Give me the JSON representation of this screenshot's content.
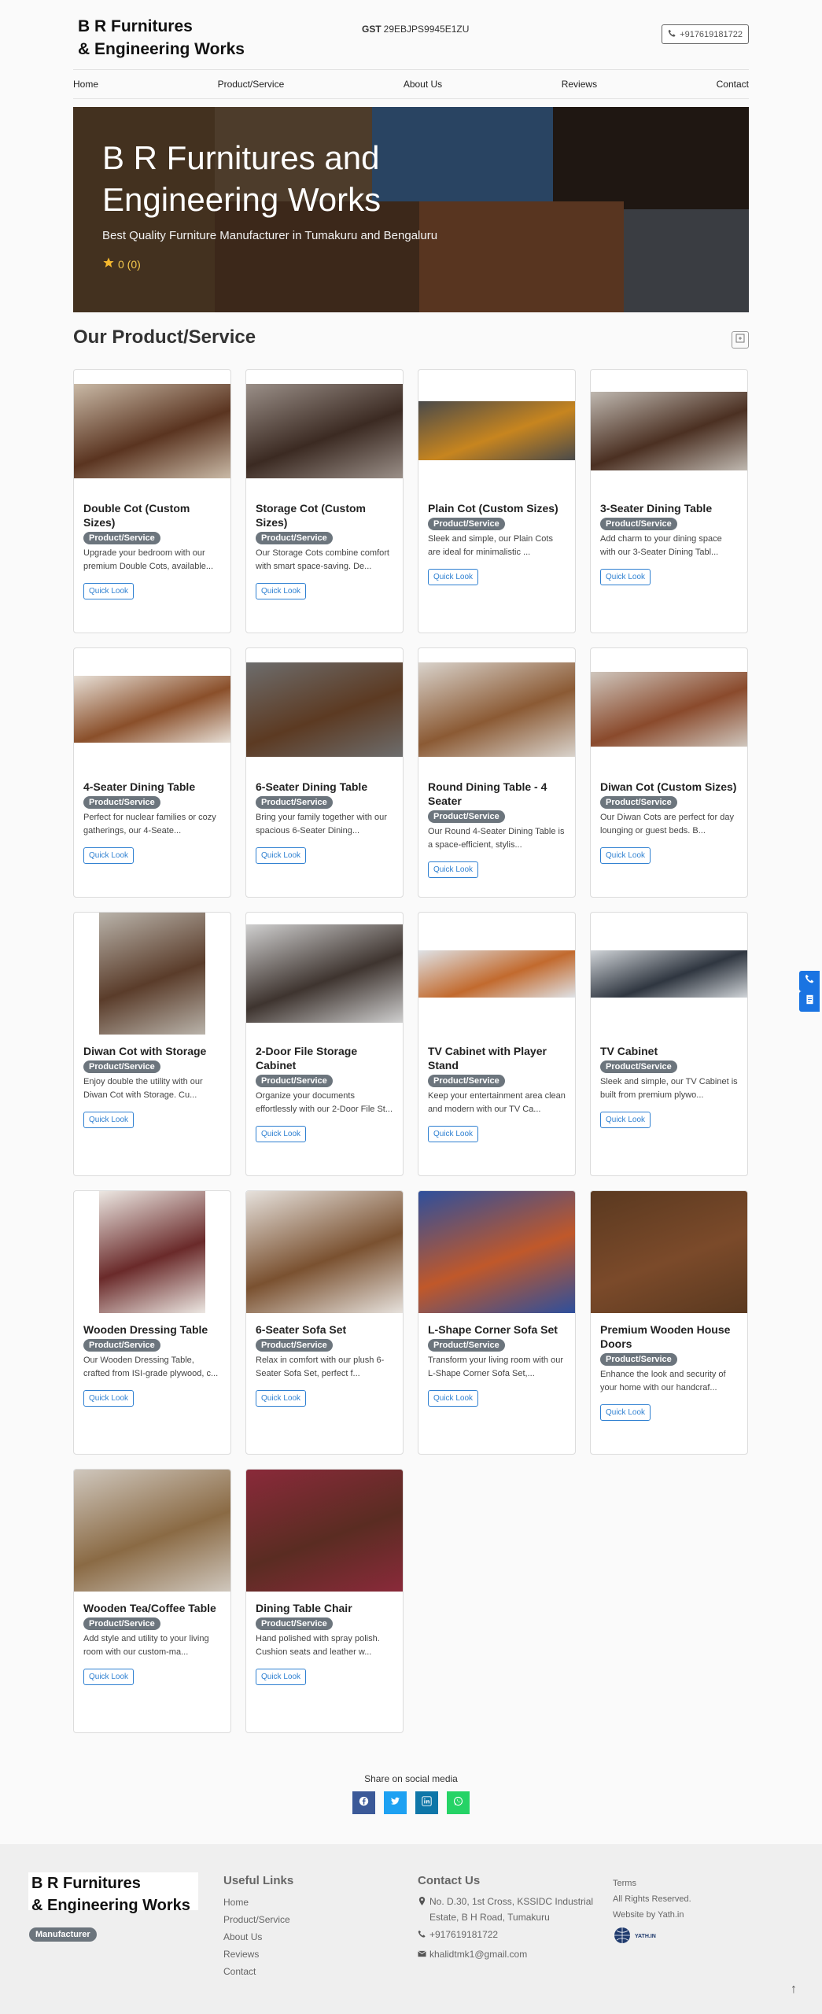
{
  "header": {
    "brand": "B R Furnitures\n& Engineering Works",
    "gst_label": "GST",
    "gst_value": "29EBJPS9945E1ZU",
    "phone": "+917619181722"
  },
  "nav": [
    "Home",
    "Product/Service",
    "About Us",
    "Reviews",
    "Contact"
  ],
  "hero": {
    "title": "B R Furnitures and Engineering Works",
    "tagline": "Best Quality Furniture Manufacturer in Tumakuru and Bengaluru",
    "rating": "0 (0)"
  },
  "section_title": "Our Product/Service",
  "badge_text": "Product/Service",
  "quick_look": "Quick Look",
  "products": [
    {
      "title": "Double Cot (Custom Sizes)",
      "desc": "Upgrade your bedroom with our premium Double Cots, available..."
    },
    {
      "title": "Storage Cot (Custom Sizes)",
      "desc": "Our Storage Cots combine comfort with smart space-saving. De..."
    },
    {
      "title": "Plain Cot (Custom Sizes)",
      "desc": "Sleek and simple, our Plain Cots are ideal for minimalistic ..."
    },
    {
      "title": "3-Seater Dining Table",
      "desc": "Add charm to your dining space with our 3-Seater Dining Tabl..."
    },
    {
      "title": "4-Seater Dining Table",
      "desc": "Perfect for nuclear families or cozy gatherings, our 4-Seate..."
    },
    {
      "title": "6-Seater Dining Table",
      "desc": "Bring your family together with our spacious 6-Seater Dining..."
    },
    {
      "title": "Round Dining Table - 4 Seater",
      "desc": "Our Round 4-Seater Dining Table is a space-efficient, stylis..."
    },
    {
      "title": "Diwan Cot (Custom Sizes)",
      "desc": "Our Diwan Cots are perfect for day lounging or guest beds. B..."
    },
    {
      "title": "Diwan Cot with Storage",
      "desc": "Enjoy double the utility with our Diwan Cot with Storage. Cu..."
    },
    {
      "title": "2-Door File Storage Cabinet",
      "desc": "Organize your documents effortlessly with our 2-Door File St..."
    },
    {
      "title": "TV Cabinet with Player Stand",
      "desc": "Keep your entertainment area clean and modern with our TV Ca..."
    },
    {
      "title": "TV Cabinet",
      "desc": "Sleek and simple, our TV Cabinet is built from premium plywo..."
    },
    {
      "title": "Wooden Dressing Table",
      "desc": "Our Wooden Dressing Table, crafted from ISI-grade plywood, c..."
    },
    {
      "title": "6-Seater Sofa Set",
      "desc": "Relax in comfort with our plush 6-Seater Sofa Set, perfect f..."
    },
    {
      "title": "L-Shape Corner Sofa Set",
      "desc": "Transform your living room with our L-Shape Corner Sofa Set,..."
    },
    {
      "title": "Premium Wooden House Doors",
      "desc": "Enhance the look and security of your home with our handcraf..."
    },
    {
      "title": "Wooden Tea/Coffee Table",
      "desc": "Add style and utility to your living room with our custom-ma..."
    },
    {
      "title": "Dining Table Chair",
      "desc": "Hand polished with spray polish. Cushion seats and leather w..."
    }
  ],
  "share": {
    "label": "Share on social media",
    "buttons": [
      {
        "icon": "facebook-icon",
        "color": "#3b5998"
      },
      {
        "icon": "twitter-icon",
        "color": "#1da1f2"
      },
      {
        "icon": "linkedin-icon",
        "color": "#0e76a8"
      },
      {
        "icon": "whatsapp-icon",
        "color": "#25d366"
      }
    ]
  },
  "footer": {
    "brand": "B R Furnitures\n& Engineering Works",
    "badge": "Manufacturer",
    "useful_links_title": "Useful Links",
    "useful_links": [
      "Home",
      "Product/Service",
      "About Us",
      "Reviews",
      "Contact"
    ],
    "contact_title": "Contact Us",
    "address": "No. D.30, 1st Cross, KSSIDC Industrial Estate, B H Road, Tumakuru",
    "phone": "+917619181722",
    "email": "khalidtmk1@gmail.com",
    "terms": "Terms",
    "rights": "All Rights Reserved.",
    "website_by": "Website by Yath.in",
    "yath_logo_label": "YATH.IN"
  },
  "colors": {
    "accent": "#2f80d1",
    "badge": "#6c757d",
    "float": "#1a74e2"
  }
}
